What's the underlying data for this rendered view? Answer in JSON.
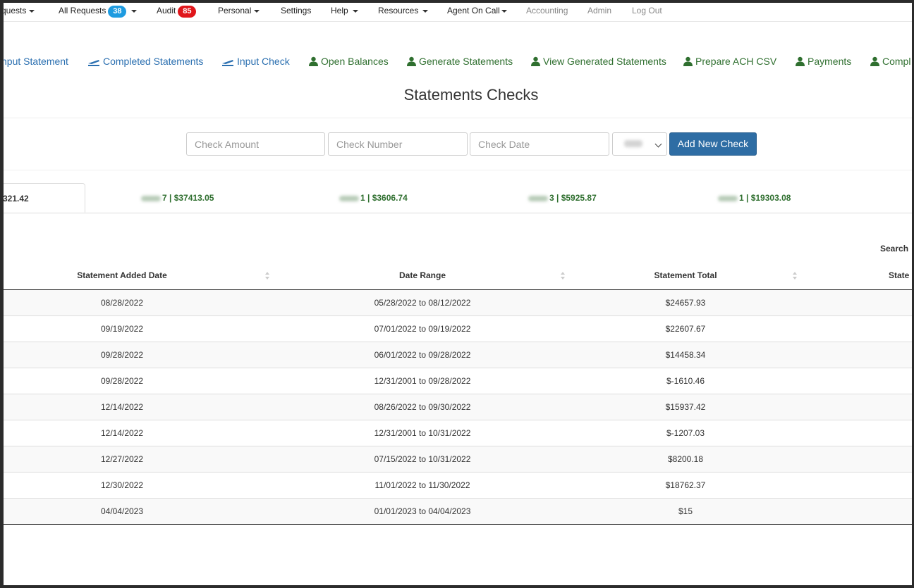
{
  "topnav": {
    "requests_label": "quests",
    "all_requests_label": "All Requests",
    "all_requests_count": "38",
    "audit_label": "Audit",
    "audit_count": "85",
    "personal_label": "Personal",
    "settings_label": "Settings",
    "help_label": "Help",
    "resources_label": "Resources",
    "agent_on_call_label": "Agent On Call",
    "accounting_label": "Accounting",
    "admin_label": "Admin",
    "logout_label": "Log Out",
    "accent_badge_blue": "#1e9be0",
    "accent_badge_red": "#e0161b"
  },
  "subnav": {
    "items": [
      {
        "label": "nput Statement",
        "icon": "plane-icon"
      },
      {
        "label": "Completed Statements",
        "icon": "plane-icon"
      },
      {
        "label": "Input Check",
        "icon": "plane-icon"
      },
      {
        "label": "Open Balances",
        "icon": "user-icon"
      },
      {
        "label": "Generate Statements",
        "icon": "user-icon"
      },
      {
        "label": "View Generated Statements",
        "icon": "user-icon"
      },
      {
        "label": "Prepare ACH CSV",
        "icon": "user-icon"
      },
      {
        "label": "Payments",
        "icon": "user-icon"
      },
      {
        "label": "Compl",
        "icon": "user-icon"
      }
    ]
  },
  "page": {
    "title": "Statements Checks"
  },
  "form": {
    "check_amount_placeholder": "Check Amount",
    "check_number_placeholder": "Check Number",
    "check_date_placeholder": "Check Date",
    "add_button_label": "Add New Check"
  },
  "tabs": [
    {
      "label": "321.42"
    },
    {
      "label": "7 | $37413.05"
    },
    {
      "label": "1 | $3606.74"
    },
    {
      "label": "3 | $5925.87"
    },
    {
      "label": "1 | $19303.08"
    }
  ],
  "search_label": "Search",
  "table": {
    "headers": [
      "Statement Added Date",
      "Date Range",
      "Statement Total",
      "State"
    ],
    "rows": [
      {
        "added": "08/28/2022",
        "range": "05/28/2022 to 08/12/2022",
        "total": "$24657.93"
      },
      {
        "added": "09/19/2022",
        "range": "07/01/2022 to 09/19/2022",
        "total": "$22607.67"
      },
      {
        "added": "09/28/2022",
        "range": "06/01/2022 to 09/28/2022",
        "total": "$14458.34"
      },
      {
        "added": "09/28/2022",
        "range": "12/31/2001 to 09/28/2022",
        "total": "$-1610.46"
      },
      {
        "added": "12/14/2022",
        "range": "08/26/2022 to 09/30/2022",
        "total": "$15937.42"
      },
      {
        "added": "12/14/2022",
        "range": "12/31/2001 to 10/31/2022",
        "total": "$-1207.03"
      },
      {
        "added": "12/27/2022",
        "range": "07/15/2022 to 10/31/2022",
        "total": "$8200.18"
      },
      {
        "added": "12/30/2022",
        "range": "11/01/2022 to 11/30/2022",
        "total": "$18762.37"
      },
      {
        "added": "04/04/2023",
        "range": "01/01/2023 to 04/04/2023",
        "total": "$15"
      }
    ]
  }
}
